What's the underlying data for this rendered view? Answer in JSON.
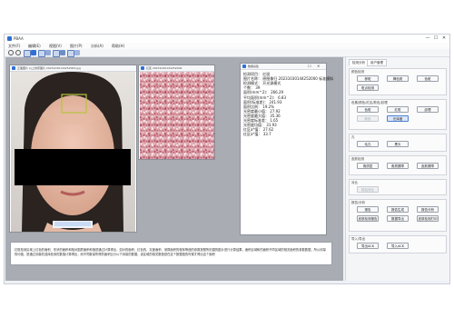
{
  "window": {
    "title": "PBAA",
    "controls": [
      "—",
      "☐",
      "✕"
    ]
  },
  "menu": [
    "文件(F)",
    "编辑(E)",
    "视图(V)",
    "图片(P)",
    "分析(A)",
    "帮助(H)"
  ],
  "toolbar": [
    "search-icon",
    "search-icon",
    "grid-icon",
    "grid-icon",
    "grid-icon",
    "grid-icon",
    "grid-icon",
    "grid-icon",
    "grid-icon",
    "grid-icon"
  ],
  "face_window": {
    "title": "正面图片 以上的原图片 20231030144252000.jpg"
  },
  "texture_window": {
    "title": "红区 20231030144252000"
  },
  "data_window": {
    "title": "数据采集",
    "rows": [
      "检测项目：  红斑",
      "图片名称：  原图像归 20231030144252000 标准模拟",
      "检测模式：  开光源模式",
      "个数：  39",
      "面积(mm^2)：      266.29",
      "平均面积(mm^2)：      6.83",
      "面积(标准差)：      241.93",
      "面积比例：    19.2%",
      "光密度最小值：      27.92",
      "光密度最大值：      35.36",
      "光密度标准差：      1.65",
      "光密度均值：      31.93",
      "红区a*值：    27.62",
      "红区a*值：    33.7"
    ]
  },
  "description": "红斑检测区域上红色的面积、形状的面积和相对图质面积和值是通过计算得出，如对的面积、红色的、灰度面积、测算面积的程序等值的参数按照所拍摄的图片进行计算结果，面积区域和的面积不同区域的相关面积的参数数据，所以测量的均值，是通过测量的选择检测的数值计算得出，而不同数量所得的面积比分以下测量的数据。该区域的相关数值是在这个数据值的时候才得出这个面积",
  "right_panel": {
    "tabs": [
      "检测分析",
      "用户管理"
    ],
    "sections": [
      {
        "label": "颜色检测",
        "buttons": [
          {
            "label": "棕斑",
            "state": "normal"
          },
          {
            "label": "褐色斑",
            "state": "normal"
          },
          {
            "label": "色斑",
            "state": "normal"
          },
          {
            "label": "斑点检测",
            "state": "normal"
          }
        ]
      },
      {
        "label": "色素/颜色/红区/肤色/纹理",
        "buttons": [
          {
            "label": "色斑",
            "state": "normal"
          },
          {
            "label": "红斑",
            "state": "normal"
          },
          {
            "label": "纹理",
            "state": "normal"
          },
          {
            "label": "肤色",
            "state": "disabled"
          },
          {
            "label": "光泽度",
            "state": "selected"
          }
        ]
      },
      {
        "label": "孔",
        "buttons": [
          {
            "label": "毛孔",
            "state": "normal"
          },
          {
            "label": "黑头",
            "state": "normal"
          }
        ]
      },
      {
        "label": "皮肤检测",
        "buttons": [
          {
            "label": "角质层",
            "state": "normal"
          },
          {
            "label": "角质屏障",
            "state": "normal"
          },
          {
            "label": "皮肤屏障",
            "state": "normal"
          }
        ]
      },
      {
        "label": "对比",
        "buttons": [
          {
            "label": "前后对比",
            "state": "disabled"
          }
        ]
      },
      {
        "label": "报告/分析",
        "buttons": [
          {
            "label": "报告",
            "state": "normal"
          },
          {
            "label": "报告生成",
            "state": "normal"
          },
          {
            "label": "报告分析",
            "state": "normal"
          },
          {
            "label": "皮肤检测报告",
            "state": "normal"
          },
          {
            "label": "数据导出",
            "state": "normal"
          },
          {
            "label": "皮肤检测打印",
            "state": "normal"
          }
        ]
      },
      {
        "label": "导入/导出",
        "buttons": [
          {
            "label": "导出ACK",
            "state": "normal"
          },
          {
            "label": "导入ACK",
            "state": "normal"
          }
        ]
      }
    ]
  },
  "colors": {
    "accent": "#2f6fd6",
    "selected_button": "#dbe7f9",
    "workspace": "#a9adb3"
  }
}
